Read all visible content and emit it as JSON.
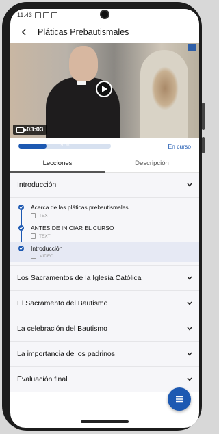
{
  "status_bar": {
    "time": "11:43"
  },
  "app_bar": {
    "title": "Pláticas Prebautismales"
  },
  "video": {
    "duration": "03:03"
  },
  "progress": {
    "percent": 30,
    "label": "30 %",
    "status": "En curso"
  },
  "tabs": [
    {
      "label": "Lecciones",
      "active": true
    },
    {
      "label": "Descripción",
      "active": false
    }
  ],
  "sections": [
    {
      "title": "Introducción",
      "expanded": true,
      "lessons": [
        {
          "title": "Acerca de las pláticas prebautismales",
          "type": "TEXT",
          "icon": "document-icon",
          "completed": true,
          "active": false
        },
        {
          "title": "ANTES DE INICIAR EL CURSO",
          "type": "TEXT",
          "icon": "document-icon",
          "completed": true,
          "active": false
        },
        {
          "title": "Introducción",
          "type": "VIDEO",
          "icon": "video-icon",
          "completed": true,
          "active": true
        }
      ]
    },
    {
      "title": "Los Sacramentos de la Iglesia Católica",
      "expanded": false
    },
    {
      "title": "El Sacramento del Bautismo",
      "expanded": false
    },
    {
      "title": "La celebración del Bautismo",
      "expanded": false
    },
    {
      "title": "La importancia de los padrinos",
      "expanded": false
    },
    {
      "title": "Evaluación final",
      "expanded": false
    }
  ],
  "colors": {
    "accent": "#1d59b2",
    "active_row": "#e6e9f4",
    "background": "#f6f6f9"
  }
}
